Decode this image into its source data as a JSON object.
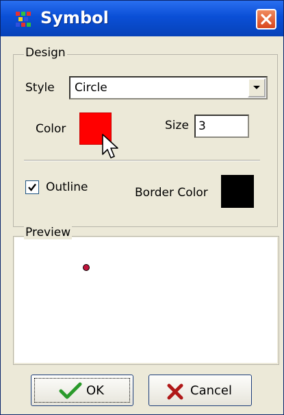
{
  "window": {
    "title": "Symbol",
    "app_icon": "colored-dots-icon",
    "close_icon": "close-icon"
  },
  "design": {
    "group_label": "Design",
    "style_label": "Style",
    "style_value": "Circle",
    "color_label": "Color",
    "color_value": "#ff0000",
    "size_label": "Size",
    "size_value": "3",
    "outline_label": "Outline",
    "outline_checked": true,
    "border_color_label": "Border Color",
    "border_color_value": "#000000"
  },
  "preview": {
    "group_label": "Preview",
    "dot_color": "#c0143c"
  },
  "buttons": {
    "ok_label": "OK",
    "ok_icon": "checkmark-icon",
    "cancel_label": "Cancel",
    "cancel_icon": "x-mark-icon"
  }
}
